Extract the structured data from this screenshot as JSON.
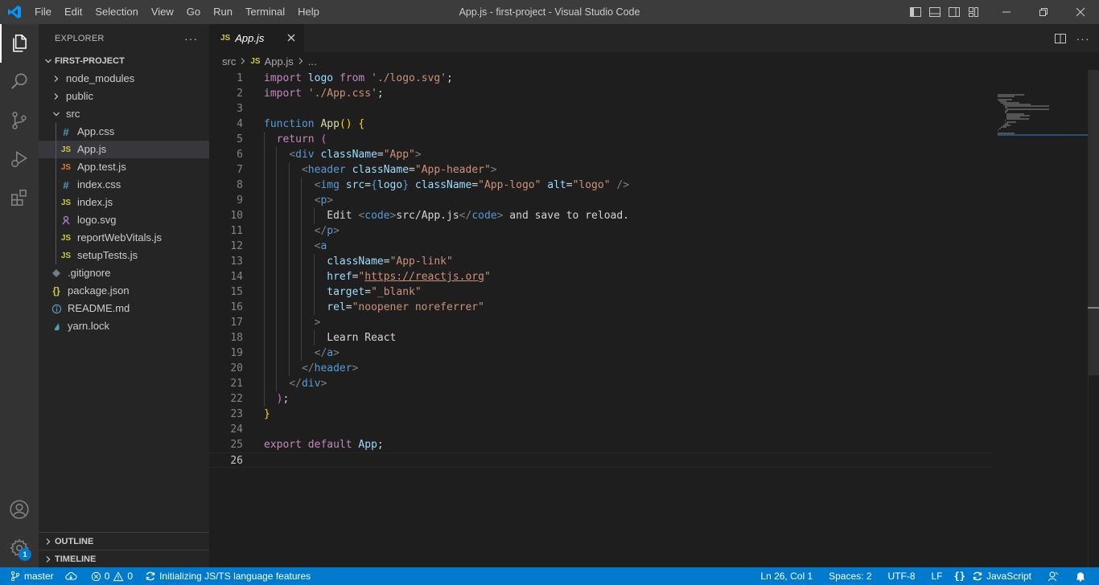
{
  "titlebar": {
    "window_title": "App.js - first-project - Visual Studio Code",
    "menu": [
      "File",
      "Edit",
      "Selection",
      "View",
      "Go",
      "Run",
      "Terminal",
      "Help"
    ]
  },
  "activitybar": {
    "items": [
      "explorer",
      "search",
      "source-control",
      "run-and-debug",
      "extensions"
    ],
    "bottom": [
      "accounts",
      "manage"
    ],
    "manage_badge": "1"
  },
  "sidebar": {
    "title": "EXPLORER",
    "project": "FIRST-PROJECT",
    "tree": [
      {
        "label": "node_modules",
        "kind": "folder",
        "depth": 0,
        "expanded": false
      },
      {
        "label": "public",
        "kind": "folder",
        "depth": 0,
        "expanded": false
      },
      {
        "label": "src",
        "kind": "folder",
        "depth": 0,
        "expanded": true
      },
      {
        "label": "App.css",
        "kind": "css",
        "depth": 1
      },
      {
        "label": "App.js",
        "kind": "js",
        "depth": 1,
        "selected": true
      },
      {
        "label": "App.test.js",
        "kind": "test",
        "depth": 1
      },
      {
        "label": "index.css",
        "kind": "css",
        "depth": 1
      },
      {
        "label": "index.js",
        "kind": "js",
        "depth": 1
      },
      {
        "label": "logo.svg",
        "kind": "svg",
        "depth": 1
      },
      {
        "label": "reportWebVitals.js",
        "kind": "js",
        "depth": 1
      },
      {
        "label": "setupTests.js",
        "kind": "js",
        "depth": 1
      },
      {
        "label": ".gitignore",
        "kind": "git",
        "depth": 0
      },
      {
        "label": "package.json",
        "kind": "json",
        "depth": 0
      },
      {
        "label": "README.md",
        "kind": "info",
        "depth": 0
      },
      {
        "label": "yarn.lock",
        "kind": "yarn",
        "depth": 0
      }
    ],
    "outline": "OUTLINE",
    "timeline": "TIMELINE"
  },
  "editor": {
    "tab_icon": "JS",
    "tab_label": "App.js",
    "breadcrumb": [
      "src",
      "App.js",
      "..."
    ],
    "current_line": 26,
    "lines": [
      [
        [
          "import",
          "kw"
        ],
        [
          " ",
          "txt"
        ],
        [
          "logo",
          "id"
        ],
        [
          " ",
          "txt"
        ],
        [
          "from",
          "kw"
        ],
        [
          " ",
          "txt"
        ],
        [
          "'./logo.svg'",
          "str"
        ],
        [
          ";",
          "txt"
        ]
      ],
      [
        [
          "import",
          "kw"
        ],
        [
          " ",
          "txt"
        ],
        [
          "'./App.css'",
          "str"
        ],
        [
          ";",
          "txt"
        ]
      ],
      [],
      [
        [
          "function",
          "kw2"
        ],
        [
          " ",
          "txt"
        ],
        [
          "App",
          "fn"
        ],
        [
          "()",
          "p1"
        ],
        [
          " ",
          "txt"
        ],
        [
          "{",
          "p1"
        ]
      ],
      [
        [
          "  ",
          "txt"
        ],
        [
          "return",
          "kw"
        ],
        [
          " ",
          "txt"
        ],
        [
          "(",
          "p2"
        ]
      ],
      [
        [
          "    ",
          "txt"
        ],
        [
          "<",
          "br"
        ],
        [
          "div",
          "tag"
        ],
        [
          " ",
          "txt"
        ],
        [
          "className",
          "attr"
        ],
        [
          "=",
          "txt"
        ],
        [
          "\"App\"",
          "str"
        ],
        [
          ">",
          "br"
        ]
      ],
      [
        [
          "      ",
          "txt"
        ],
        [
          "<",
          "br"
        ],
        [
          "header",
          "tag"
        ],
        [
          " ",
          "txt"
        ],
        [
          "className",
          "attr"
        ],
        [
          "=",
          "txt"
        ],
        [
          "\"App-header\"",
          "str"
        ],
        [
          ">",
          "br"
        ]
      ],
      [
        [
          "        ",
          "txt"
        ],
        [
          "<",
          "br"
        ],
        [
          "img",
          "tag"
        ],
        [
          " ",
          "txt"
        ],
        [
          "src",
          "attr"
        ],
        [
          "=",
          "txt"
        ],
        [
          "{",
          "kw2"
        ],
        [
          "logo",
          "id"
        ],
        [
          "}",
          "kw2"
        ],
        [
          " ",
          "txt"
        ],
        [
          "className",
          "attr"
        ],
        [
          "=",
          "txt"
        ],
        [
          "\"App-logo\"",
          "str"
        ],
        [
          " ",
          "txt"
        ],
        [
          "alt",
          "attr"
        ],
        [
          "=",
          "txt"
        ],
        [
          "\"logo\"",
          "str"
        ],
        [
          " ",
          "txt"
        ],
        [
          "/>",
          "br"
        ]
      ],
      [
        [
          "        ",
          "txt"
        ],
        [
          "<",
          "br"
        ],
        [
          "p",
          "tag"
        ],
        [
          ">",
          "br"
        ]
      ],
      [
        [
          "          ",
          "txt"
        ],
        [
          "Edit ",
          "txt"
        ],
        [
          "<",
          "br"
        ],
        [
          "code",
          "tag"
        ],
        [
          ">",
          "br"
        ],
        [
          "src/App.js",
          "txt"
        ],
        [
          "</",
          "br"
        ],
        [
          "code",
          "tag"
        ],
        [
          ">",
          "br"
        ],
        [
          " and save to reload.",
          "txt"
        ]
      ],
      [
        [
          "        ",
          "txt"
        ],
        [
          "</",
          "br"
        ],
        [
          "p",
          "tag"
        ],
        [
          ">",
          "br"
        ]
      ],
      [
        [
          "        ",
          "txt"
        ],
        [
          "<",
          "br"
        ],
        [
          "a",
          "tag"
        ]
      ],
      [
        [
          "          ",
          "txt"
        ],
        [
          "className",
          "attr"
        ],
        [
          "=",
          "txt"
        ],
        [
          "\"App-link\"",
          "str"
        ]
      ],
      [
        [
          "          ",
          "txt"
        ],
        [
          "href",
          "attr"
        ],
        [
          "=",
          "txt"
        ],
        [
          "\"",
          "str"
        ],
        [
          "https://reactjs.org",
          "str link"
        ],
        [
          "\"",
          "str"
        ]
      ],
      [
        [
          "          ",
          "txt"
        ],
        [
          "target",
          "attr"
        ],
        [
          "=",
          "txt"
        ],
        [
          "\"_blank\"",
          "str"
        ]
      ],
      [
        [
          "          ",
          "txt"
        ],
        [
          "rel",
          "attr"
        ],
        [
          "=",
          "txt"
        ],
        [
          "\"noopener noreferrer\"",
          "str"
        ]
      ],
      [
        [
          "        ",
          "txt"
        ],
        [
          ">",
          "br"
        ]
      ],
      [
        [
          "          ",
          "txt"
        ],
        [
          "Learn React",
          "txt"
        ]
      ],
      [
        [
          "        ",
          "txt"
        ],
        [
          "</",
          "br"
        ],
        [
          "a",
          "tag"
        ],
        [
          ">",
          "br"
        ]
      ],
      [
        [
          "      ",
          "txt"
        ],
        [
          "</",
          "br"
        ],
        [
          "header",
          "tag"
        ],
        [
          ">",
          "br"
        ]
      ],
      [
        [
          "    ",
          "txt"
        ],
        [
          "</",
          "br"
        ],
        [
          "div",
          "tag"
        ],
        [
          ">",
          "br"
        ]
      ],
      [
        [
          "  ",
          "txt"
        ],
        [
          ")",
          "p2"
        ],
        [
          ";",
          "txt"
        ]
      ],
      [
        [
          "}",
          "p1"
        ]
      ],
      [],
      [
        [
          "export",
          "kw"
        ],
        [
          " ",
          "txt"
        ],
        [
          "default",
          "kw"
        ],
        [
          " ",
          "txt"
        ],
        [
          "App",
          "id"
        ],
        [
          ";",
          "txt"
        ]
      ],
      []
    ]
  },
  "statusbar": {
    "branch": "master",
    "errors": "0",
    "warnings": "0",
    "progress": "Initializing JS/TS language features",
    "position": "Ln 26, Col 1",
    "spaces": "Spaces: 2",
    "encoding": "UTF-8",
    "eol": "LF",
    "language": "JavaScript"
  },
  "colors": {
    "accent": "#007acc",
    "js_icon": "#cbcb41",
    "css_icon": "#519aba",
    "test_icon": "#e37933"
  }
}
